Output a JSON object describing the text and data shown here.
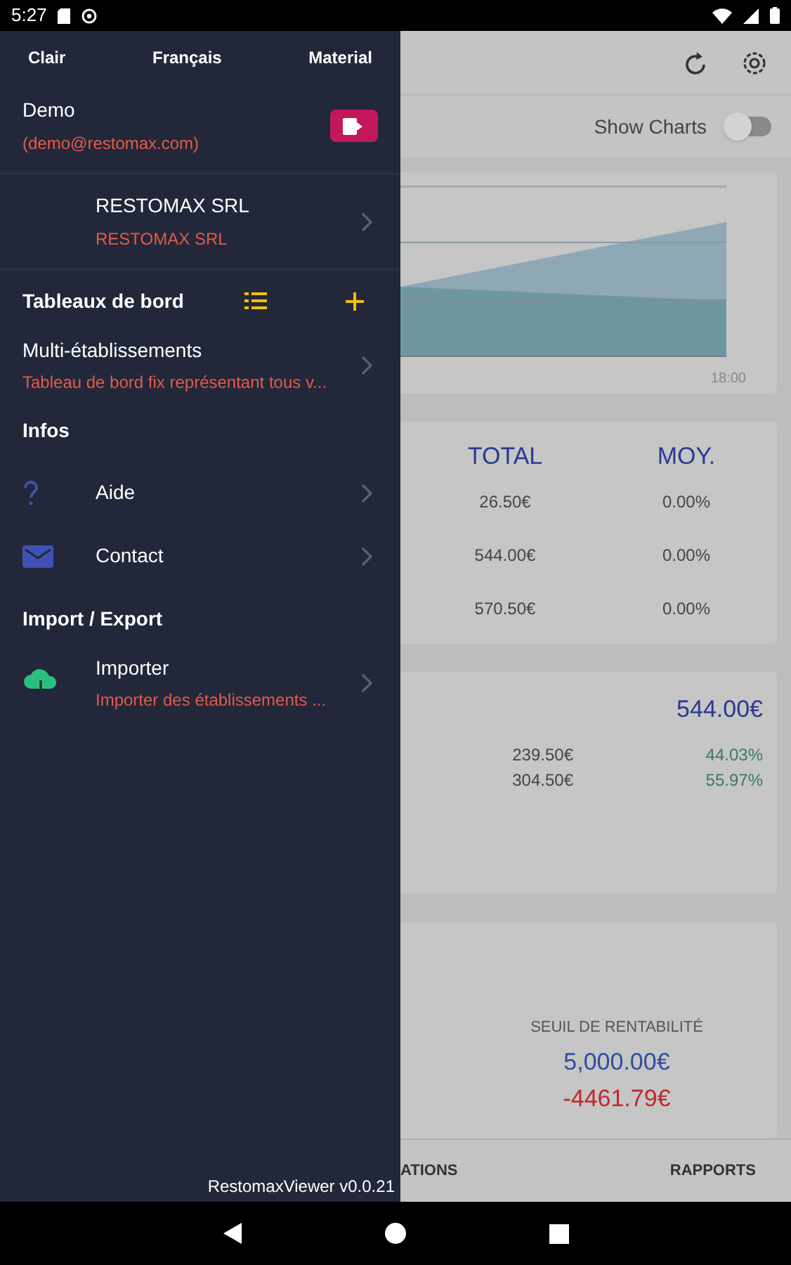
{
  "status_bar": {
    "time": "5:27"
  },
  "drawer": {
    "settings": [
      "Clair",
      "Français",
      "Material"
    ],
    "user": {
      "name": "Demo",
      "email": "(demo@restomax.com)"
    },
    "company": {
      "title": "RESTOMAX SRL",
      "subtitle": "RESTOMAX SRL"
    },
    "sections": [
      {
        "title": "Tableaux de bord",
        "kind": "dashboards",
        "items": [
          {
            "kind": "plain",
            "title": "Multi-établissements",
            "subtitle": "Tableau de bord fix représentant tous v..."
          }
        ]
      },
      {
        "title": "Infos",
        "kind": "plain",
        "items": [
          {
            "kind": "help",
            "title": "Aide"
          },
          {
            "kind": "mail",
            "title": "Contact"
          }
        ]
      },
      {
        "title": "Import / Export",
        "kind": "plain",
        "items": [
          {
            "kind": "cloud",
            "title": "Importer",
            "subtitle": "Importer des établissements ..."
          }
        ]
      }
    ],
    "version": "RestomaxViewer v0.0.21"
  },
  "toolbar": {
    "show_charts": {
      "label": "Show Charts",
      "on": false
    }
  },
  "chart_card": {
    "x_label": "18:00"
  },
  "totals_card": {
    "columns": [
      "TOTAL",
      "MOY."
    ],
    "rows": [
      [
        "26.50€",
        "0.00%"
      ],
      [
        "544.00€",
        "0.00%"
      ],
      [
        "570.50€",
        "0.00%"
      ]
    ]
  },
  "split_card": {
    "total": "544.00€",
    "rows": [
      {
        "amount": "239.50€",
        "percent": "44.03%"
      },
      {
        "amount": "304.50€",
        "percent": "55.97%"
      }
    ]
  },
  "breakeven_card": {
    "label": "SEUIL DE RENTABILITÉ",
    "target": "5,000.00€",
    "difference": "-4461.79€"
  },
  "bottom_tabs": [
    {
      "label": "ATIONS",
      "selected": false
    },
    {
      "label": "RAPPORTS",
      "selected": false
    }
  ]
}
